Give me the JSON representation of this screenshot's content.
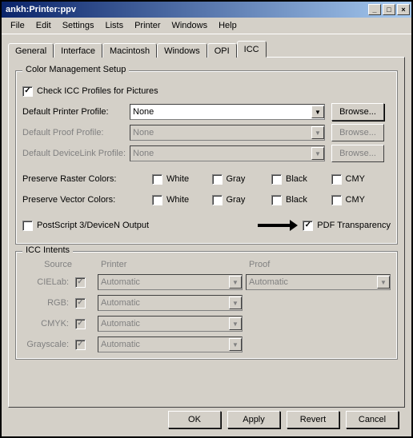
{
  "window": {
    "title": "ankh:Printer:ppv"
  },
  "titlebar_buttons": {
    "min": "_",
    "max": "□",
    "close": "×"
  },
  "menu": [
    "File",
    "Edit",
    "Settings",
    "Lists",
    "Printer",
    "Windows",
    "Help"
  ],
  "tabs": [
    "General",
    "Interface",
    "Macintosh",
    "Windows",
    "OPI",
    "ICC"
  ],
  "active_tab": "ICC",
  "group_color_mgmt": {
    "title": "Color Management Setup",
    "check_profiles": "Check ICC Profiles for Pictures",
    "printer_profile_label": "Default Printer Profile:",
    "printer_profile_value": "None",
    "proof_profile_label": "Default Proof Profile:",
    "proof_profile_value": "None",
    "devicelink_label": "Default DeviceLink Profile:",
    "devicelink_value": "None",
    "browse": "Browse...",
    "preserve_raster_label": "Preserve Raster Colors:",
    "preserve_vector_label": "Preserve Vector Colors:",
    "colors": {
      "white": "White",
      "gray": "Gray",
      "black": "Black",
      "cmy": "CMY"
    },
    "postscript_label": "PostScript 3/DeviceN Output",
    "pdf_transparency_label": "PDF Transparency"
  },
  "group_intents": {
    "title": "ICC Intents",
    "head_source": "Source",
    "head_printer": "Printer",
    "head_proof": "Proof",
    "rows": [
      {
        "label": "CIELab:",
        "printer": "Automatic",
        "proof": "Automatic"
      },
      {
        "label": "RGB:",
        "printer": "Automatic",
        "proof": ""
      },
      {
        "label": "CMYK:",
        "printer": "Automatic",
        "proof": ""
      },
      {
        "label": "Grayscale:",
        "printer": "Automatic",
        "proof": ""
      }
    ]
  },
  "buttons": {
    "ok": "OK",
    "apply": "Apply",
    "revert": "Revert",
    "cancel": "Cancel"
  }
}
